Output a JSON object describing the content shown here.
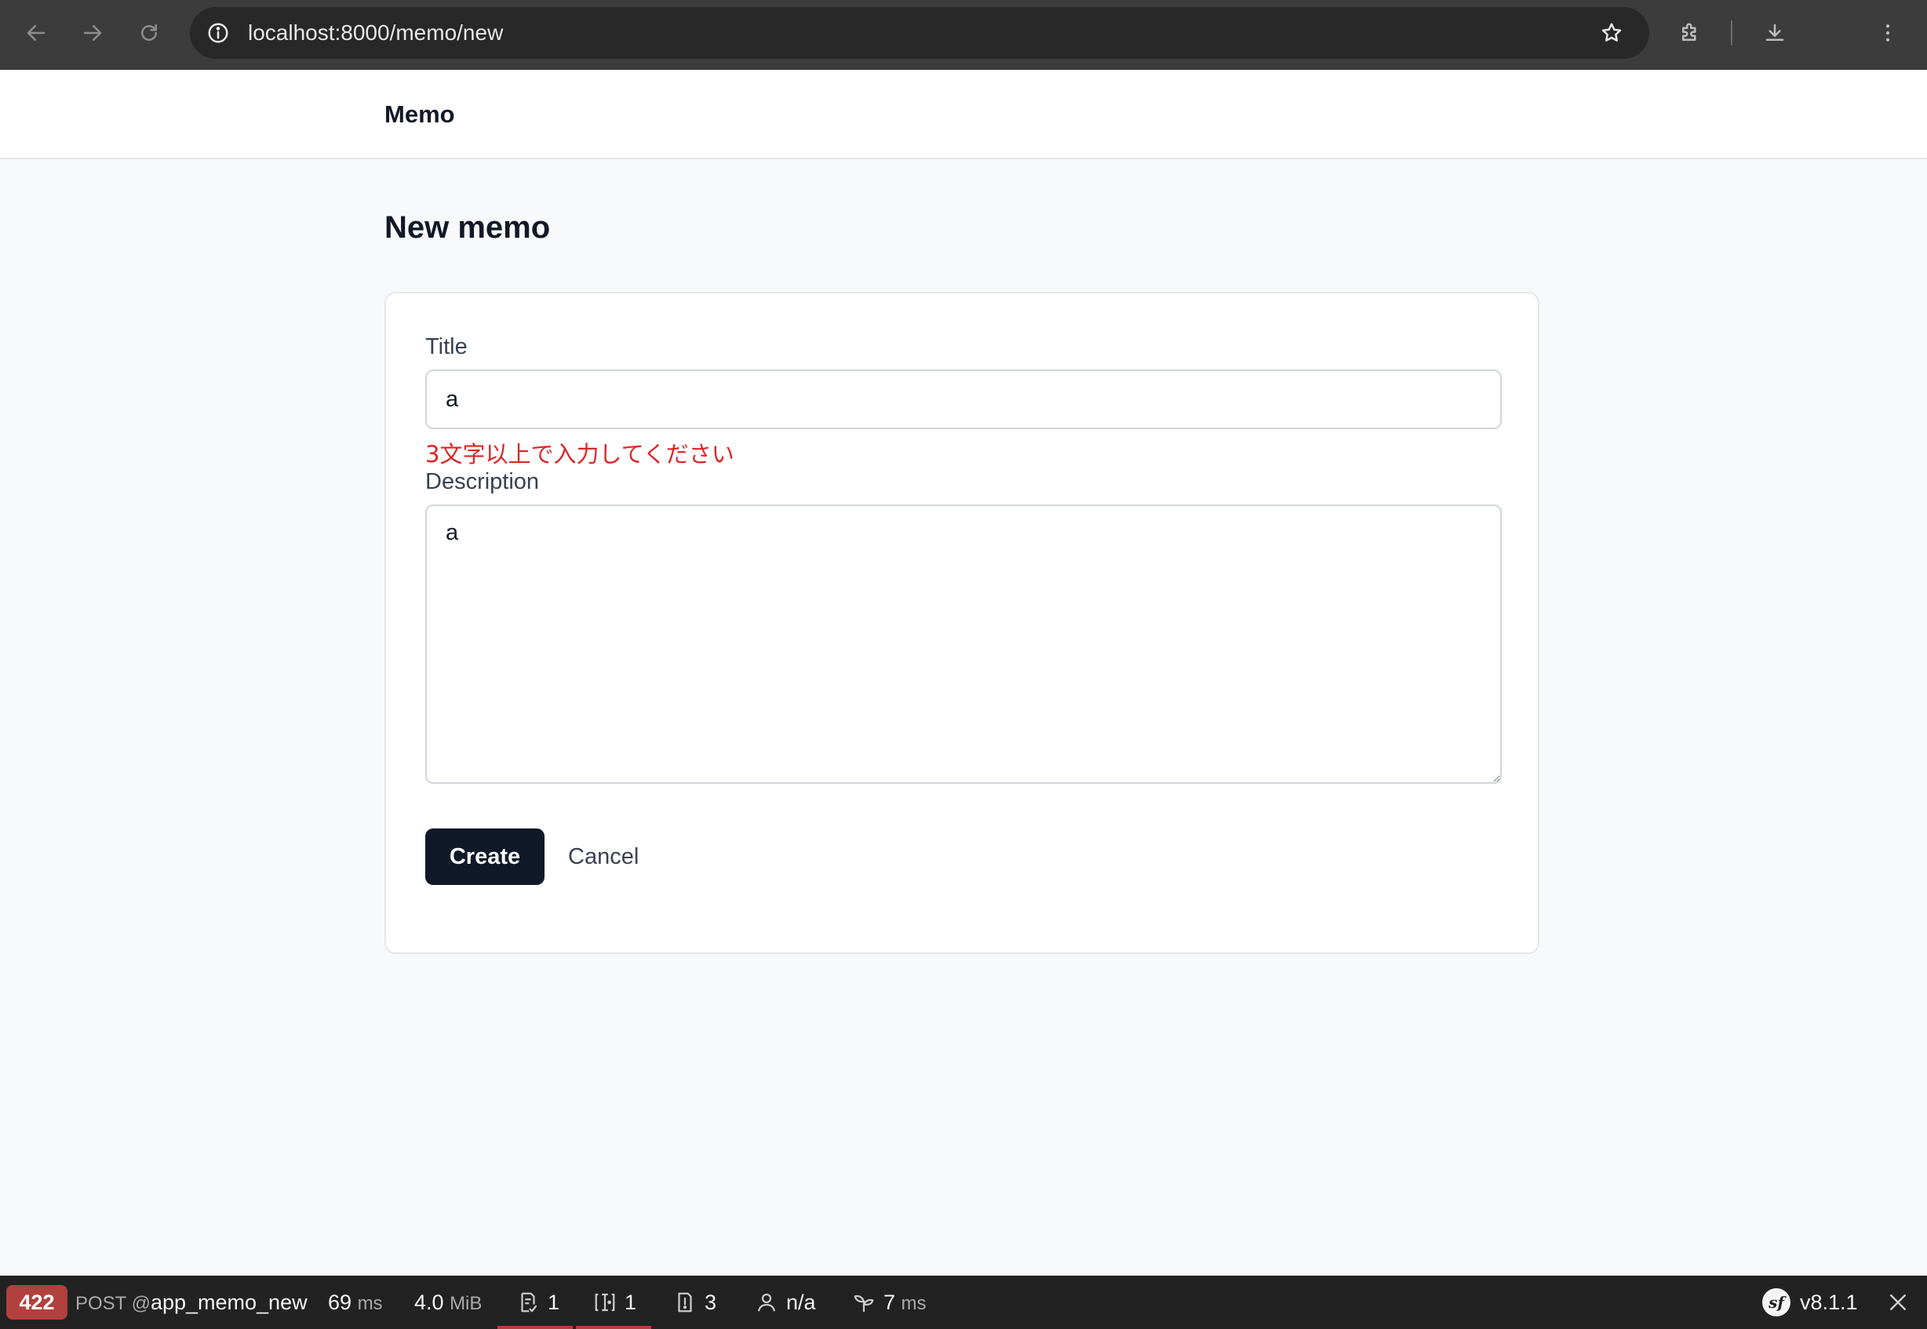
{
  "browser": {
    "url": "localhost:8000/memo/new"
  },
  "app": {
    "brand": "Memo"
  },
  "page": {
    "title": "New memo"
  },
  "form": {
    "title_label": "Title",
    "title_value": "a",
    "title_error": "3文字以上で入力してください",
    "description_label": "Description",
    "description_value": "a",
    "create_label": "Create",
    "cancel_label": "Cancel"
  },
  "toolbar": {
    "status_code": "422",
    "method_prefix": "POST @",
    "route": "app_memo_new",
    "time_value": "69",
    "time_unit": "ms",
    "memory_value": "4.0",
    "memory_unit": "MiB",
    "forms_count": "1",
    "validator_count": "1",
    "logs_count": "3",
    "user": "n/a",
    "twig_value": "7",
    "twig_unit": "ms",
    "version": "v8.1.1",
    "error_color": "#b0413e"
  }
}
